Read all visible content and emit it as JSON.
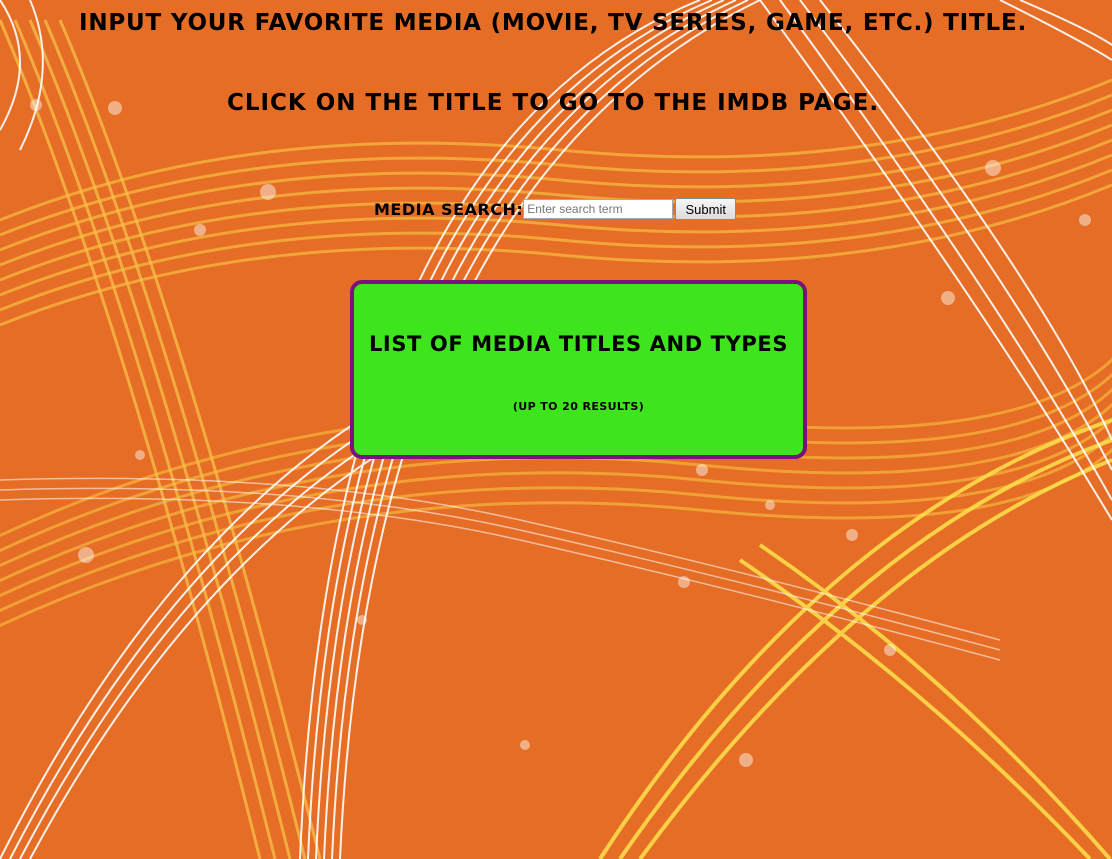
{
  "header": {
    "instruction_line1": "Input your favorite media (Movie, TV Series, Game, etc.) title.",
    "instruction_line2": "Click on the title to go to the IMDB page."
  },
  "search": {
    "label": "Media Search:",
    "placeholder": "Enter search term",
    "value": "",
    "submit_label": "Submit"
  },
  "results": {
    "title": "List of Media Titles and Types",
    "subtitle": "(up to 20 results)"
  },
  "colors": {
    "background": "#e66d25",
    "results_box": "#3fe51c",
    "results_border": "#79127a"
  }
}
